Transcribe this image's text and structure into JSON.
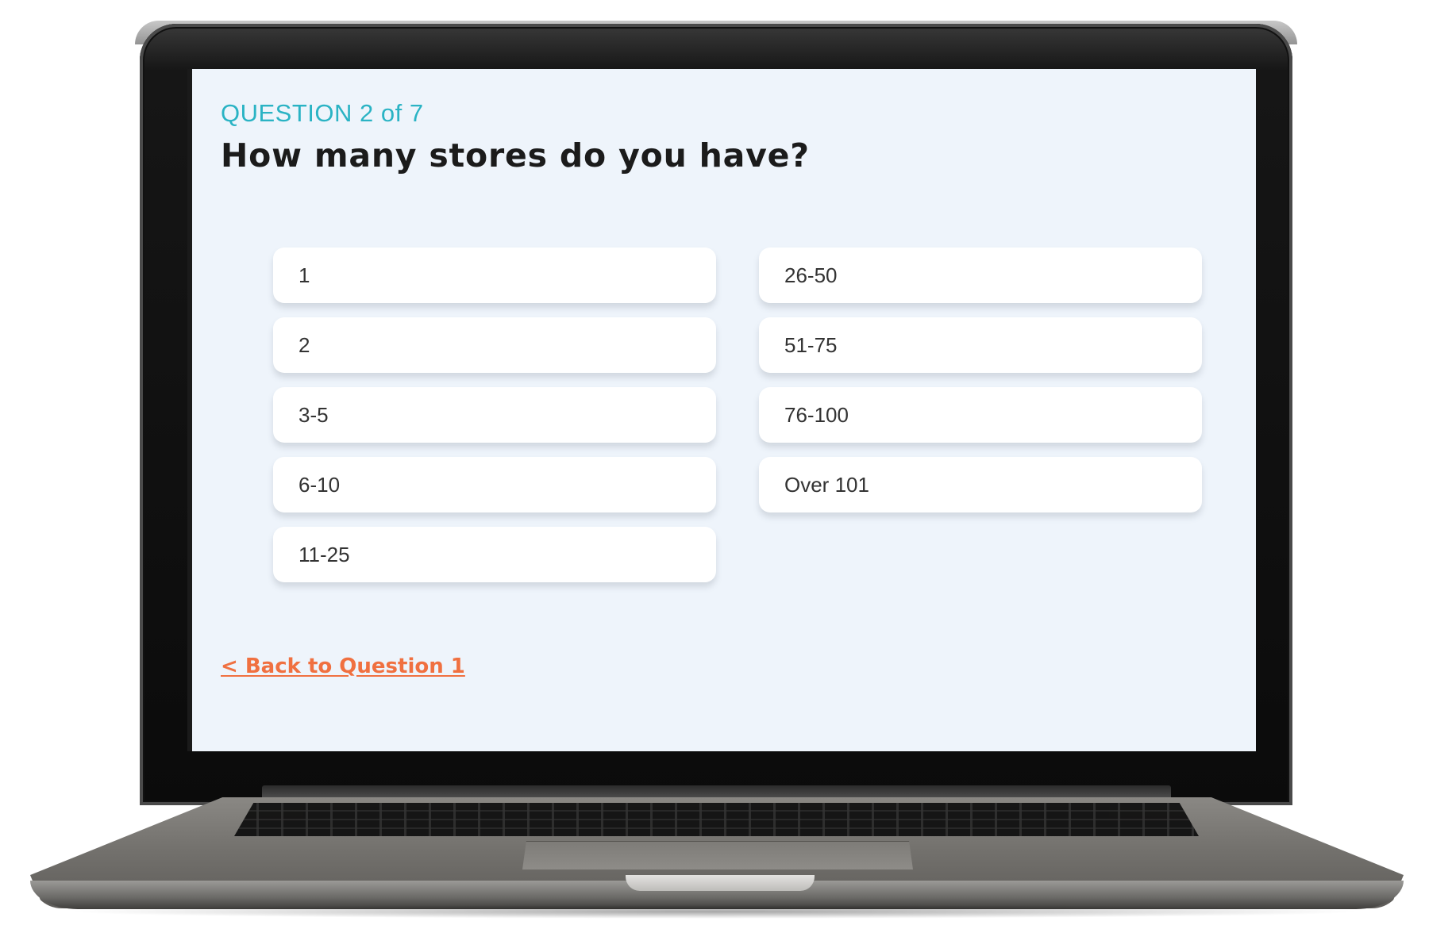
{
  "quiz": {
    "counter": "QUESTION 2 of 7",
    "title": "How many stores do you have?",
    "options_left": [
      "1",
      "2",
      "3-5",
      "6-10",
      "11-25"
    ],
    "options_right": [
      "26-50",
      "51-75",
      "76-100",
      "Over 101"
    ],
    "back_link": "< Back to Question 1"
  },
  "colors": {
    "screen_background": "#eef4fb",
    "counter_accent": "#2ab3c4",
    "back_link_accent": "#f07040",
    "option_background": "#ffffff"
  }
}
